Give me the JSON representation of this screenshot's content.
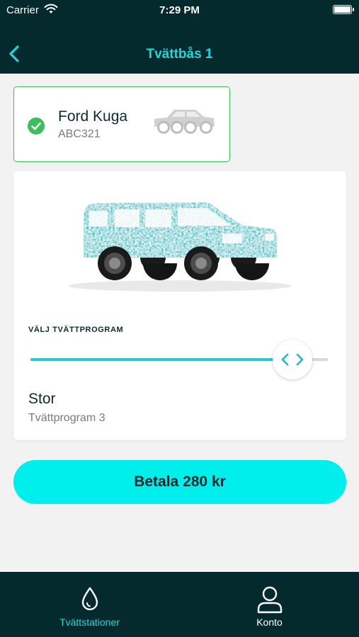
{
  "status_bar": {
    "carrier": "Carrier",
    "time": "7:29 PM"
  },
  "header": {
    "title": "Tvättbås 1"
  },
  "vehicle": {
    "name": "Ford Kuga",
    "plate": "ABC321",
    "selected": true
  },
  "program": {
    "section_label": "VÄLJ TVÄTTPROGRAM",
    "name": "Stor",
    "subtitle": "Tvättprogram 3",
    "slider_level": 0.88
  },
  "pay_button": {
    "label": "Betala 280 kr"
  },
  "tabs": [
    {
      "label": "Tvättstationer",
      "icon": "drop-icon",
      "active": true
    },
    {
      "label": "Konto",
      "icon": "user-icon",
      "active": false
    }
  ],
  "colors": {
    "brand_dark": "#042a2d",
    "accent": "#1fd6dc",
    "pay_button": "#00efec",
    "success": "#3bbf5c",
    "car_teal": "#1fc3c8"
  }
}
